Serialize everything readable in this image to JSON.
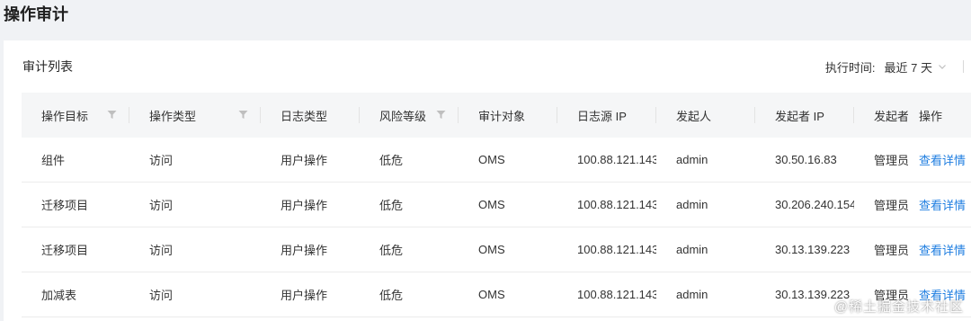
{
  "page": {
    "title": "操作审计"
  },
  "card": {
    "title": "审计列表"
  },
  "toolbar": {
    "time_label": "执行时间:",
    "time_value": "最近 7 天"
  },
  "table": {
    "columns": [
      "操作目标",
      "操作类型",
      "日志类型",
      "风险等级",
      "审计对象",
      "日志源 IP",
      "发起人",
      "发起者 IP",
      "发起者角色",
      "操作"
    ],
    "rows": [
      {
        "target": "组件",
        "op_type": "访问",
        "log_type": "用户操作",
        "risk": "低危",
        "object": "OMS",
        "source_ip": "100.88.121.143",
        "initiator": "admin",
        "initiator_ip": "30.50.16.83",
        "role": "管理员",
        "action": "查看详情"
      },
      {
        "target": "迁移项目",
        "op_type": "访问",
        "log_type": "用户操作",
        "risk": "低危",
        "object": "OMS",
        "source_ip": "100.88.121.143",
        "initiator": "admin",
        "initiator_ip": "30.206.240.154",
        "role": "管理员",
        "action": "查看详情"
      },
      {
        "target": "迁移项目",
        "op_type": "访问",
        "log_type": "用户操作",
        "risk": "低危",
        "object": "OMS",
        "source_ip": "100.88.121.143",
        "initiator": "admin",
        "initiator_ip": "30.13.139.223",
        "role": "管理员",
        "action": "查看详情"
      },
      {
        "target": "加减表",
        "op_type": "访问",
        "log_type": "用户操作",
        "risk": "低危",
        "object": "OMS",
        "source_ip": "100.88.121.143",
        "initiator": "admin",
        "initiator_ip": "30.13.139.223",
        "role": "管理员",
        "action": "查看详情"
      }
    ]
  },
  "watermark": "@稀土掘金技术社区",
  "icons": {
    "filter": "filter-icon",
    "chevron": "chevron-down-icon"
  },
  "colors": {
    "link": "#1f7ee0",
    "header_bg": "#f5f6f7",
    "page_bg": "#f0f2f5"
  }
}
